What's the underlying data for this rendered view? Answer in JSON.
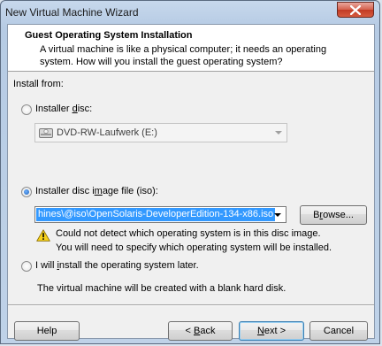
{
  "window": {
    "title": "New Virtual Machine Wizard"
  },
  "header": {
    "title": "Guest Operating System Installation",
    "description": "A virtual machine is like a physical computer; it needs an operating system. How will you install the guest operating system?"
  },
  "install_from": {
    "label": "Install from:",
    "disc_option": {
      "label_pre": "Installer ",
      "label_key": "d",
      "label_post": "isc:",
      "selected": false
    },
    "disc_drive": {
      "value": "DVD-RW-Laufwerk (E:)",
      "icon": "dvd-drive-icon"
    },
    "iso_option": {
      "label_pre": "Installer disc i",
      "label_key": "m",
      "label_post": "age file (iso):",
      "selected": true
    },
    "iso_path": {
      "value": "hines\\@iso\\OpenSolaris-DeveloperEdition-134-x86.iso"
    },
    "browse_button": {
      "label_pre": "B",
      "label_key": "r",
      "label_post": "owse..."
    },
    "warning": {
      "icon": "warning-icon",
      "line1": "Could not detect which operating system is in this disc image.",
      "line2": "You will need to specify which operating system will be installed."
    },
    "later_option": {
      "label_pre": "I will ",
      "label_key": "i",
      "label_post": "nstall the operating system later.",
      "selected": false
    },
    "later_note": "The virtual machine will be created with a blank hard disk."
  },
  "footer": {
    "help": "Help",
    "back_pre": "< ",
    "back_key": "B",
    "back_post": "ack",
    "next_pre": "",
    "next_key": "N",
    "next_post": "ext >",
    "cancel": "Cancel"
  },
  "colors": {
    "selection": "#3399ff",
    "warning_yellow": "#f7d21a",
    "close_red": "#c23b24"
  }
}
